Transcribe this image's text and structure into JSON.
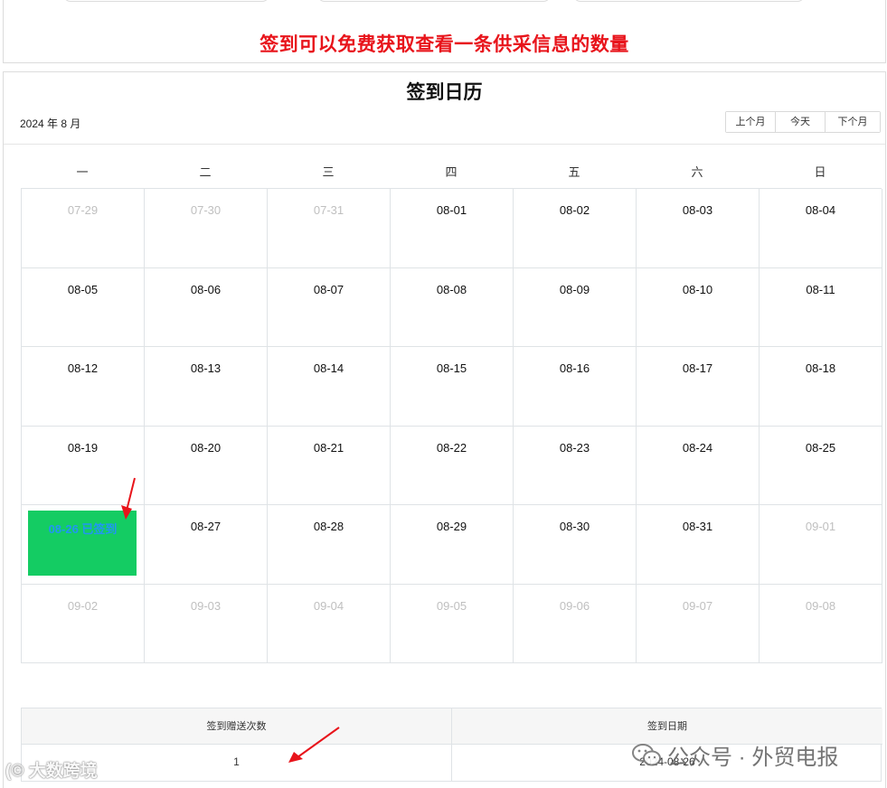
{
  "top_panel": {
    "notice": "签到可以免费获取查看一条供采信息的数量"
  },
  "calendar": {
    "title": "签到日历",
    "month_label": "2024 年 8 月",
    "nav": {
      "prev": "上个月",
      "today": "今天",
      "next": "下个月"
    },
    "weekdays": [
      "一",
      "二",
      "三",
      "四",
      "五",
      "六",
      "日"
    ],
    "days": [
      {
        "label": "07-29",
        "other": true
      },
      {
        "label": "07-30",
        "other": true
      },
      {
        "label": "07-31",
        "other": true
      },
      {
        "label": "08-01"
      },
      {
        "label": "08-02"
      },
      {
        "label": "08-03"
      },
      {
        "label": "08-04"
      },
      {
        "label": "08-05"
      },
      {
        "label": "08-06"
      },
      {
        "label": "08-07"
      },
      {
        "label": "08-08"
      },
      {
        "label": "08-09"
      },
      {
        "label": "08-10"
      },
      {
        "label": "08-11"
      },
      {
        "label": "08-12"
      },
      {
        "label": "08-13"
      },
      {
        "label": "08-14"
      },
      {
        "label": "08-15"
      },
      {
        "label": "08-16"
      },
      {
        "label": "08-17"
      },
      {
        "label": "08-18"
      },
      {
        "label": "08-19"
      },
      {
        "label": "08-20"
      },
      {
        "label": "08-21"
      },
      {
        "label": "08-22"
      },
      {
        "label": "08-23"
      },
      {
        "label": "08-24"
      },
      {
        "label": "08-25"
      },
      {
        "label": "08-26 已签到",
        "signed": true
      },
      {
        "label": "08-27"
      },
      {
        "label": "08-28"
      },
      {
        "label": "08-29"
      },
      {
        "label": "08-30"
      },
      {
        "label": "08-31"
      },
      {
        "label": "09-01",
        "other": true
      },
      {
        "label": "09-02",
        "other": true
      },
      {
        "label": "09-03",
        "other": true
      },
      {
        "label": "09-04",
        "other": true
      },
      {
        "label": "09-05",
        "other": true
      },
      {
        "label": "09-06",
        "other": true
      },
      {
        "label": "09-07",
        "other": true
      },
      {
        "label": "09-08",
        "other": true
      }
    ]
  },
  "stats": {
    "headers": [
      "签到赠送次数",
      "签到日期"
    ],
    "row": [
      "1",
      "2024-08-26"
    ]
  },
  "watermarks": {
    "left": "大数跨境",
    "right": "公众号 · 外贸电报"
  },
  "colors": {
    "notice": "#e8141b",
    "signed_bg": "#14cc63",
    "signed_text": "#2196f3",
    "arrow": "#e8141b"
  }
}
